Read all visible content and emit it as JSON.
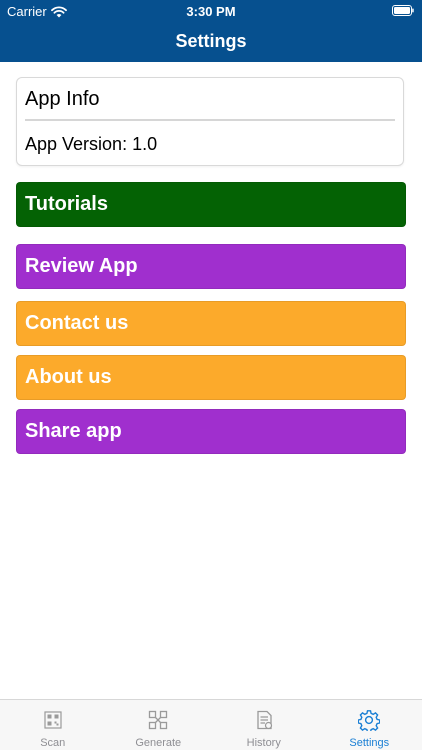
{
  "status_bar": {
    "carrier": "Carrier",
    "time": "3:30 PM"
  },
  "nav": {
    "title": "Settings"
  },
  "app_info": {
    "title": "App Info",
    "version": "App Version: 1.0"
  },
  "menu": [
    {
      "label": "Tutorials",
      "color": "#046204"
    },
    {
      "label": "Review App",
      "color": "#a02fce"
    },
    {
      "label": "Contact us",
      "color": "#fcaa2b"
    },
    {
      "label": "About us",
      "color": "#fcaa2b"
    },
    {
      "label": "Share app",
      "color": "#a02fce"
    }
  ],
  "tabs": [
    {
      "label": "Scan",
      "icon": "qr-code-icon",
      "active": false
    },
    {
      "label": "Generate",
      "icon": "generate-code-icon",
      "active": false
    },
    {
      "label": "History",
      "icon": "history-document-icon",
      "active": false
    },
    {
      "label": "Settings",
      "icon": "gear-icon",
      "active": true
    }
  ],
  "colors": {
    "nav_bar": "#06508f",
    "tab_active": "#1a7fd4",
    "tab_inactive": "#8e8e93"
  }
}
